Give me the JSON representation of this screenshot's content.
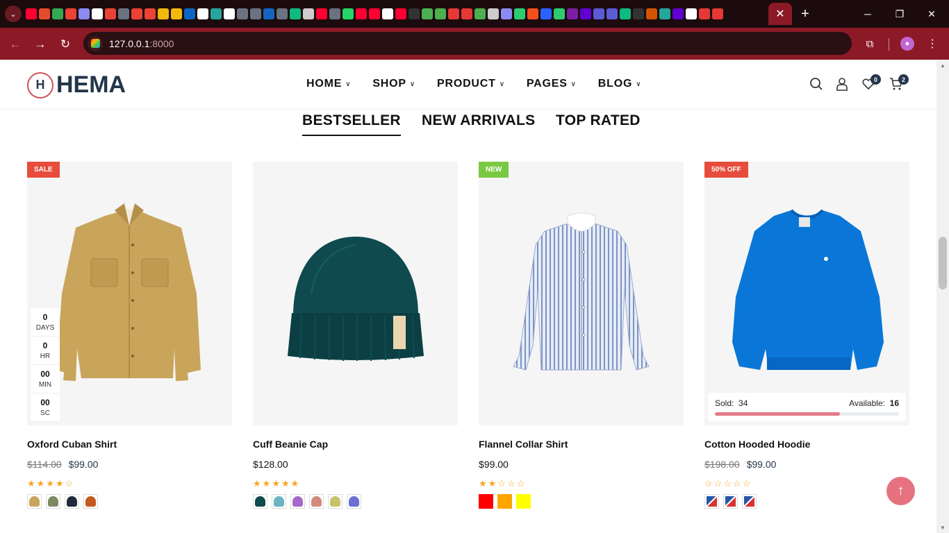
{
  "browser": {
    "url_host": "127.0.0.1",
    "url_port": ":8000",
    "tab_menu_icon": "chevron-down-icon",
    "new_tab_icon": "plus-icon",
    "close_tab_icon": "close-icon",
    "favicon_colors": [
      "#ff0033",
      "#e44c2c",
      "#34a853",
      "#ea4335",
      "#8a8af0",
      "#ffffff",
      "#ea4335",
      "#6b7280",
      "#ea4335",
      "#ea4335",
      "#f0b90b",
      "#f0b90b",
      "#0a66c2",
      "#ffffff",
      "#26a69a",
      "#ffffff",
      "#6b7280",
      "#6b7280",
      "#1565c0",
      "#6b7280",
      "#10b981",
      "#cccccc",
      "#ff0033",
      "#6b7280",
      "#25d366",
      "#ff0033",
      "#ff0033",
      "#ffffff",
      "#ff0033",
      "#333333",
      "#4caf50",
      "#4caf50",
      "#e53935",
      "#e53935",
      "#4caf50",
      "#cccccc",
      "#8a8af0",
      "#2ecc71",
      "#f24e1e",
      "#2962ff",
      "#2ecc71",
      "#7b1fa2",
      "#6001d2",
      "#5b5bd6",
      "#5b5bd6",
      "#10b981",
      "#333333",
      "#d35400",
      "#26a69a",
      "#6001d2",
      "#ffffff",
      "#e53935",
      "#e53935"
    ]
  },
  "header": {
    "logo_text": "HEMA",
    "logo_mark": "H",
    "nav": [
      {
        "label": "HOME"
      },
      {
        "label": "SHOP"
      },
      {
        "label": "PRODUCT"
      },
      {
        "label": "PAGES"
      },
      {
        "label": "BLOG"
      }
    ],
    "wishlist_count": "0",
    "cart_count": "2"
  },
  "product_tabs": [
    "BESTSELLER",
    "NEW ARRIVALS",
    "TOP RATED"
  ],
  "countdown": [
    {
      "num": "0",
      "label": "DAYS"
    },
    {
      "num": "0",
      "label": "HR"
    },
    {
      "num": "00",
      "label": "MIN"
    },
    {
      "num": "00",
      "label": "SC"
    }
  ],
  "products": [
    {
      "name": "Oxford Cuban Shirt",
      "tag": "SALE",
      "tag_color": "#e74c3c",
      "old_price": "$114.00",
      "price": "$99.00",
      "rating": 4,
      "swatch_colors": [
        "#c9a55c",
        "#7c8a62",
        "#1f2a3d",
        "#c25a1e"
      ]
    },
    {
      "name": "Cuff Beanie Cap",
      "tag": "",
      "tag_color": "",
      "old_price": "",
      "price": "$128.00",
      "rating": 5,
      "swatch_colors": [
        "#0e4a4e",
        "#6cb4c4",
        "#a667c9",
        "#d28a7a",
        "#c9c26a",
        "#6a6fd0"
      ]
    },
    {
      "name": "Flannel Collar Shirt",
      "tag": "NEW",
      "tag_color": "#7ac943",
      "old_price": "",
      "price": "$99.00",
      "rating": 2,
      "swatch_colors": [
        "#ff0000",
        "#ffa500",
        "#ffff00"
      ]
    },
    {
      "name": "Cotton Hooded Hoodie",
      "tag": "50% OFF",
      "tag_color": "#e74c3c",
      "old_price": "$198.00",
      "price": "$99.00",
      "rating": 0,
      "swatch_colors": [
        "#2855a8",
        "#2855a8",
        "#2855a8"
      ],
      "sold_label": "Sold:",
      "sold": "34",
      "available_label": "Available:",
      "available": "16",
      "sold_fraction": 0.68
    }
  ]
}
